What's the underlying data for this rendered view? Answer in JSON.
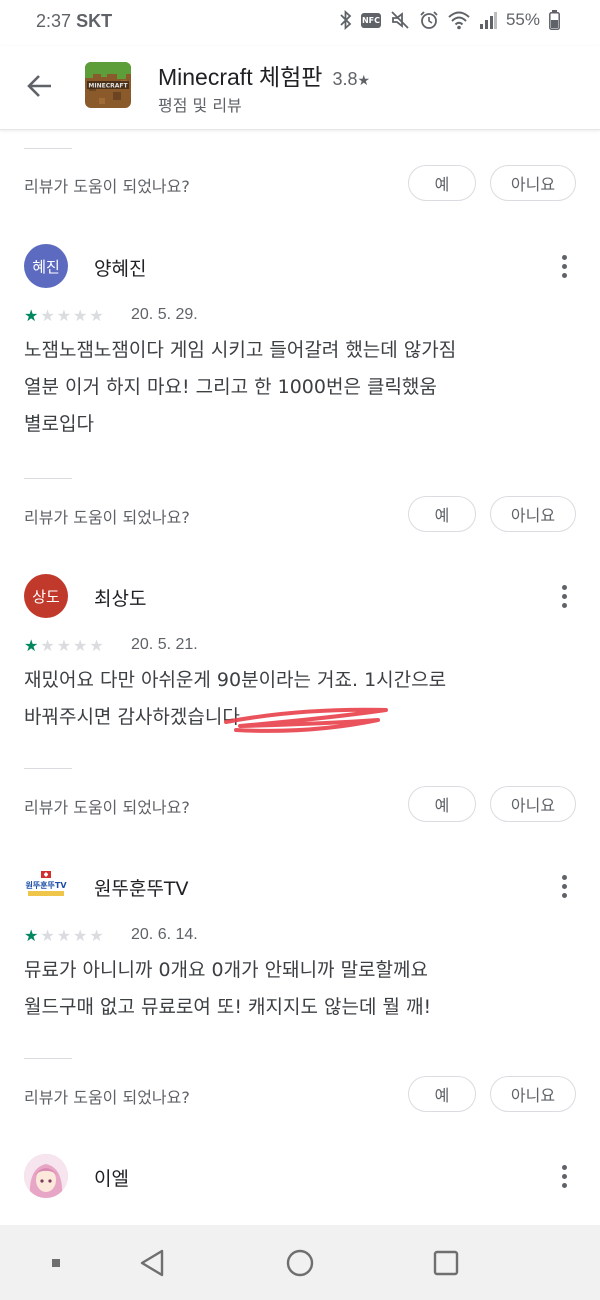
{
  "status_bar": {
    "time": "2:37",
    "carrier": "SKT",
    "nfc_label": "NFC",
    "battery": "55%"
  },
  "app_bar": {
    "title": "Minecraft 체험판",
    "rating": "3.8",
    "rating_star": "★",
    "subtitle": "평점 및 리뷰",
    "icon_text": "MINECRAFT"
  },
  "helpful": {
    "label": "리뷰가 도움이 되었나요?",
    "yes": "예",
    "no": "아니요"
  },
  "reviews": [
    {
      "name": "양혜진",
      "avatar_text": "혜진",
      "avatar_color": "#5c6bc0",
      "stars": 1,
      "date": "20. 5. 29.",
      "text": "노잼노잼노잼이다 게임 시키고 들어갈려 했는데 않가짐\n열분 이거 하지 마요! 그리고 한 1000번은 클릭했움\n별로입다"
    },
    {
      "name": "최상도",
      "avatar_text": "상도",
      "avatar_color": "#c0392b",
      "stars": 1,
      "date": "20. 5. 21.",
      "text": "재밌어요 다만 아쉬운게 90분이라는 거죠. 1시간으로\n바꿔주시면 감사하겠습니다"
    },
    {
      "name": "원뚜훈뚜TV",
      "avatar_text": "원뚜훈뚜TV",
      "avatar_color": "#ffffff",
      "stars": 1,
      "date": "20. 6. 14.",
      "text": "뮤료가 아니니까 0개요 0개가 안돼니까 말로할께요\n월드구매 없고 뮤료로여 또! 캐지지도 않는데 뭘 깨!"
    },
    {
      "name": "이엘",
      "avatar_color": "#e8c8d8"
    }
  ],
  "colors": {
    "star_on": "#01875f",
    "star_off": "#dadce0",
    "scribble": "#e8404a"
  }
}
